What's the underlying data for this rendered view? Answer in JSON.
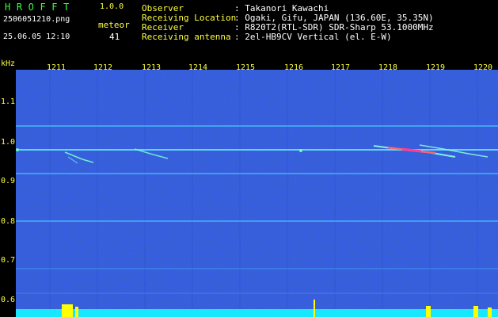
{
  "header": {
    "app_title": "HROFFT",
    "app_version": "1.0.0",
    "filename": "2506051210.png",
    "meteor_label": "meteor",
    "datetime": "25.06.05 12:10",
    "meteor_count": "41",
    "info": [
      {
        "label": "Observer",
        "value": ": Takanori Kawachi"
      },
      {
        "label": "Receiving Location",
        "value": ": Ogaki, Gifu, JAPAN (136.60E, 35.35N)"
      },
      {
        "label": "Receiver",
        "value": ": R820T2(RTL-SDR) SDR-Sharp 53.1000MHz"
      },
      {
        "label": "Receiving antenna",
        "value": ": 2el-HB9CV Vertical (el. E-W)"
      }
    ]
  },
  "axes": {
    "y_unit": "kHz",
    "y_ticks": [
      "1.1",
      "1.0",
      "0.9",
      "0.8",
      "0.7",
      "0.6"
    ],
    "x_ticks": [
      "1211",
      "1212",
      "1213",
      "1214",
      "1215",
      "1216",
      "1217",
      "1218",
      "1219",
      "1220"
    ]
  },
  "colors": {
    "background": "#000000",
    "spectrogram_base": "#0b1a7a",
    "label_yellow": "#ffff3c",
    "title_green": "#3cff3c",
    "signal_cyan": "#3cf0ff",
    "meteor_red": "#ff3c3c",
    "baseline_yellow": "#ffff00"
  }
}
